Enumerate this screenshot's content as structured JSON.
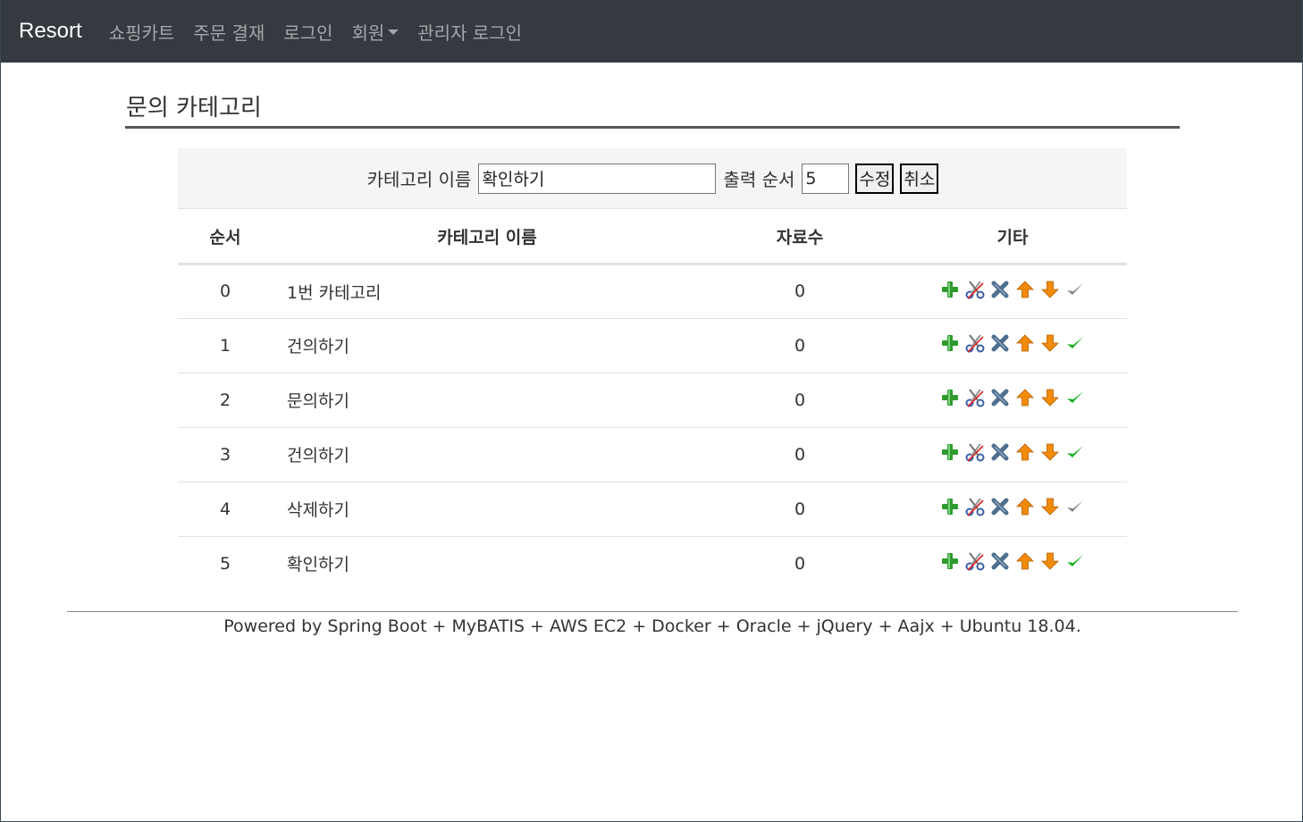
{
  "navbar": {
    "brand": "Resort",
    "items": [
      "쇼핑카트",
      "주문 결재",
      "로그인",
      "회원",
      "관리자 로그인"
    ]
  },
  "page": {
    "title": "문의 카테고리"
  },
  "form": {
    "name_label": "카테고리 이름",
    "name_value": "확인하기",
    "seq_label": "출력 순서",
    "seq_value": "5",
    "update_button": "수정",
    "cancel_button": "취소"
  },
  "table": {
    "headers": [
      "순서",
      "카테고리 이름",
      "자료수",
      "기타"
    ],
    "rows": [
      {
        "seq": "0",
        "name": "1번 카테고리",
        "count": "0",
        "visible": false
      },
      {
        "seq": "1",
        "name": "건의하기",
        "count": "0",
        "visible": true
      },
      {
        "seq": "2",
        "name": "문의하기",
        "count": "0",
        "visible": true
      },
      {
        "seq": "3",
        "name": "건의하기",
        "count": "0",
        "visible": true
      },
      {
        "seq": "4",
        "name": "삭제하기",
        "count": "0",
        "visible": false
      },
      {
        "seq": "5",
        "name": "확인하기",
        "count": "0",
        "visible": true
      }
    ]
  },
  "icons": {
    "add": "plus-icon",
    "edit": "scissors-icon",
    "delete": "x-icon",
    "up": "arrow-up-icon",
    "down": "arrow-down-icon",
    "visible": "check-icon"
  },
  "colors": {
    "navbar_bg": "#343a40",
    "check_on": "#11b11b",
    "check_off": "#888888",
    "arrow": "#f28a0a",
    "plus": "#2e9b2e",
    "delete": "#4f6f8f"
  },
  "footer": {
    "text": "Powered by Spring Boot + MyBATIS + AWS EC2 + Docker + Oracle + jQuery + Aajx + Ubuntu 18.04."
  }
}
